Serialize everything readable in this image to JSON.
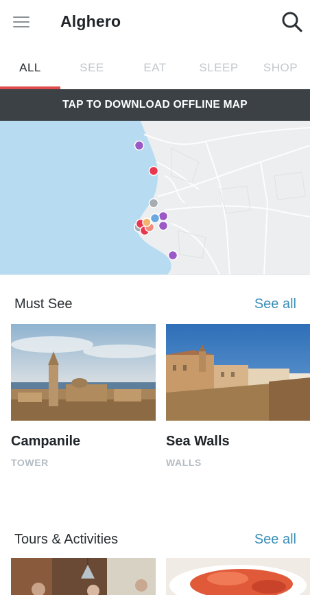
{
  "header": {
    "title": "Alghero"
  },
  "tabs": [
    {
      "label": "ALL",
      "active": true
    },
    {
      "label": "SEE",
      "active": false
    },
    {
      "label": "EAT",
      "active": false
    },
    {
      "label": "SLEEP",
      "active": false
    },
    {
      "label": "SHOP",
      "active": false
    }
  ],
  "banner": {
    "label": "TAP TO DOWNLOAD OFFLINE MAP"
  },
  "colors": {
    "accent": "#e04a4a",
    "link": "#3a8fb7",
    "banner_bg": "#3c4145",
    "pin_purple": "#9b59c6",
    "pin_red": "#e8384f",
    "pin_gray": "#a8adb2",
    "pin_blue": "#6aa8e0",
    "pin_orange": "#f08a7a",
    "water": "#b7dcf2"
  },
  "must_see": {
    "title": "Must See",
    "see_all": "See all",
    "cards": [
      {
        "name": "Campanile",
        "category": "TOWER"
      },
      {
        "name": "Sea Walls",
        "category": "WALLS"
      }
    ]
  },
  "tours": {
    "title": "Tours & Activities",
    "see_all": "See all"
  }
}
